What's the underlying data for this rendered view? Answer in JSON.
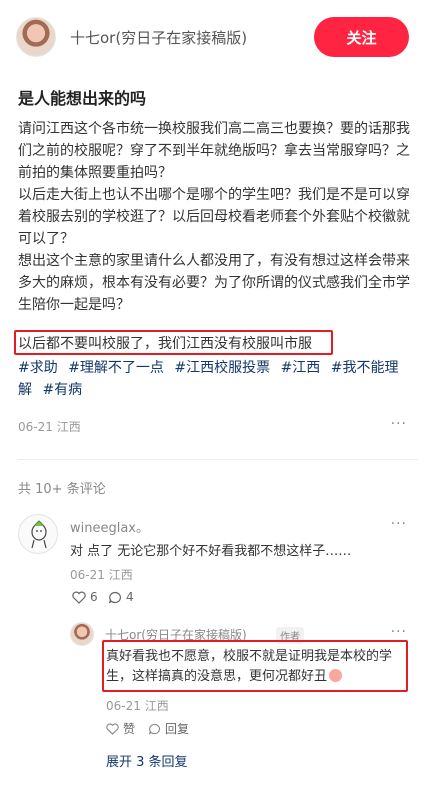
{
  "header": {
    "author_name": "十七or(穷日子在家接稿版)",
    "follow_label": "关注"
  },
  "post": {
    "title": "是人能想出来的吗",
    "paragraphs": [
      "请问江西这个各市统一换校服我们高二高三也要换？要的话那我们之前的校服呢？穿了不到半年就绝版吗？拿去当常服穿吗？之前拍的集体照要重拍吗？",
      "以后走大街上也认不出哪个是哪个的学生吧？我们是不是可以穿着校服去别的学校逛了？以后回母校看老师套个外套贴个校徽就可以了？",
      "想出这个主意的家里请什么人都没用了，有没有想过这样会带来多大的麻烦，根本有没有必要？为了你所谓的仪式感我们全市学生陪你一起是吗？"
    ],
    "highlight": "以后都不要叫校服了，我们江西没有校服叫市服",
    "tags": [
      "#求助",
      "#理解不了一点",
      "#江西校服投票",
      "#江西",
      "#我不能理解",
      "#有病"
    ],
    "date": "06-21",
    "location": "江西",
    "more_label": "···"
  },
  "comments": {
    "count_label": "共 10+ 条评论",
    "items": [
      {
        "username": "wineeglax。",
        "text": "对 点了 无论它那个好不好看我都不想这样子……",
        "date": "06-21",
        "location": "江西",
        "likes": "6",
        "replies": "4"
      }
    ],
    "reply": {
      "username": "十七or(穷日子在家接稿版)",
      "badge": "作者",
      "text": "真好看我也不愿意，校服不就是证明我是本校的学生，这样搞真的没意思，更何况都好丑",
      "date": "06-21",
      "location": "江西",
      "like_label": "赞",
      "reply_label": "回复"
    },
    "expand_label": "展开 3 条回复"
  }
}
